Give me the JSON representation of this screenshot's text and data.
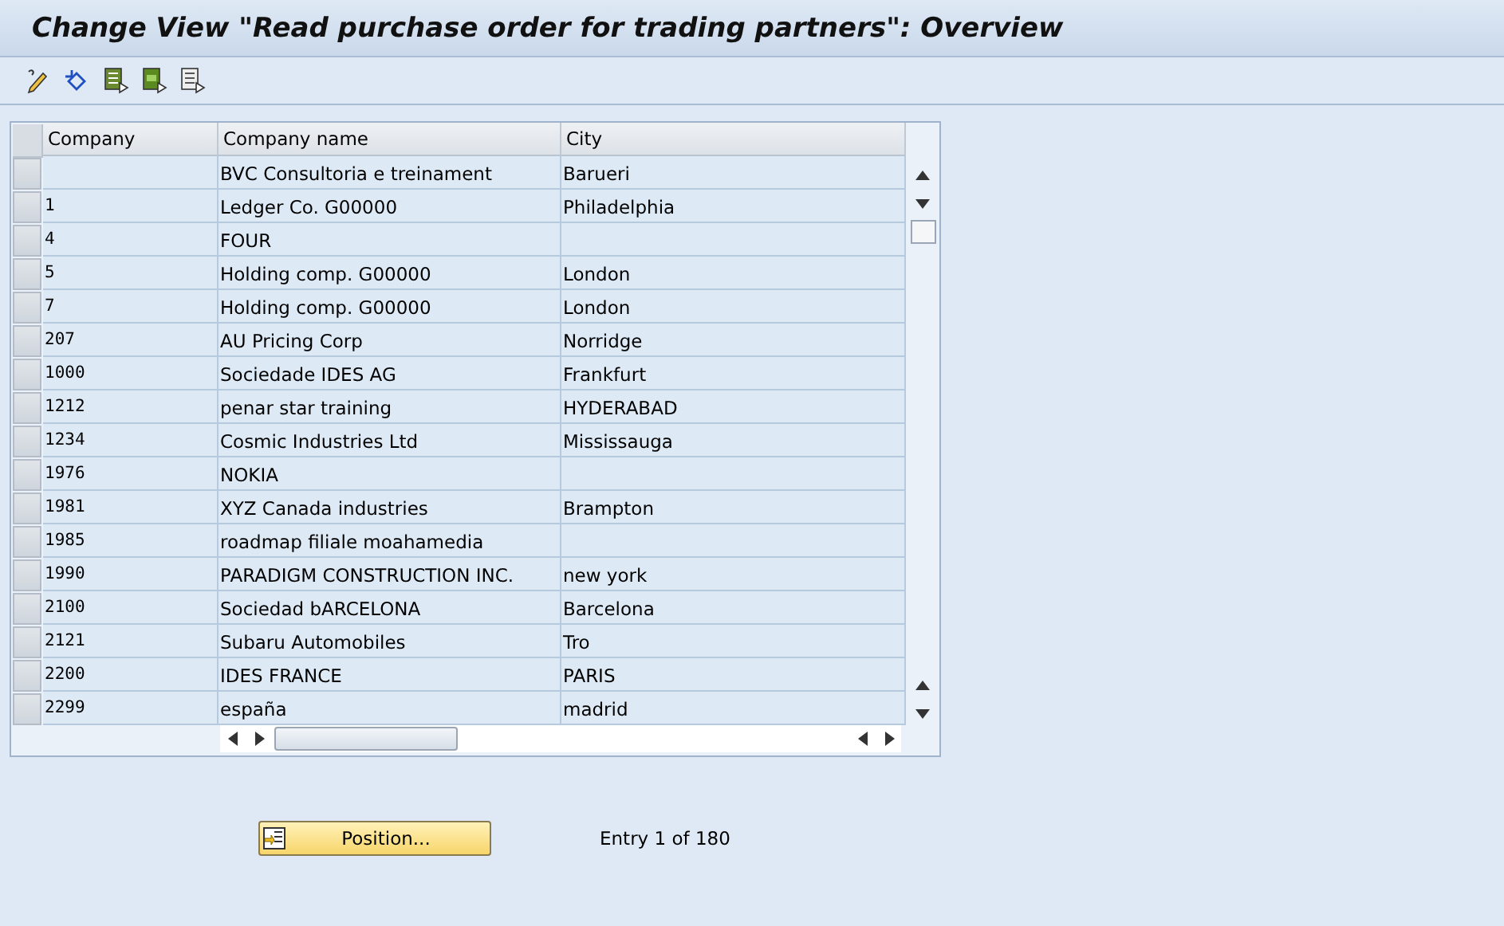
{
  "window": {
    "title": "Change View \"Read purchase order for trading partners\": Overview"
  },
  "toolbar": {
    "buttons": [
      {
        "kind": "edit"
      },
      {
        "kind": "undo"
      },
      {
        "kind": "select-all"
      },
      {
        "kind": "select-block"
      },
      {
        "kind": "deselect-all"
      }
    ]
  },
  "table": {
    "columns": [
      "Company",
      "Company name",
      "City"
    ],
    "rows": [
      [
        "",
        "BVC Consultoria e treinament",
        "Barueri"
      ],
      [
        "1",
        "Ledger Co. G00000",
        "Philadelphia"
      ],
      [
        "4",
        "FOUR",
        ""
      ],
      [
        "5",
        "Holding comp. G00000",
        "London"
      ],
      [
        "7",
        "Holding comp. G00000",
        "London"
      ],
      [
        "207",
        "AU Pricing Corp",
        "Norridge"
      ],
      [
        "1000",
        "Sociedade IDES AG",
        "Frankfurt"
      ],
      [
        "1212",
        "penar star training",
        "HYDERABAD"
      ],
      [
        "1234",
        "Cosmic Industries Ltd",
        "Mississauga"
      ],
      [
        "1976",
        "NOKIA",
        ""
      ],
      [
        "1981",
        "XYZ Canada industries",
        "Brampton"
      ],
      [
        "1985",
        "roadmap filiale moahamedia",
        ""
      ],
      [
        "1990",
        "PARADIGM CONSTRUCTION INC.",
        "new york"
      ],
      [
        "2100",
        "Sociedad bARCELONA",
        "Barcelona"
      ],
      [
        "2121",
        "Subaru Automobiles",
        "Tro"
      ],
      [
        "2200",
        "IDES FRANCE",
        "PARIS"
      ],
      [
        "2299",
        "españa",
        "madrid"
      ]
    ]
  },
  "footer": {
    "button": "Position...",
    "entry_info": "Entry 1 of 180"
  }
}
